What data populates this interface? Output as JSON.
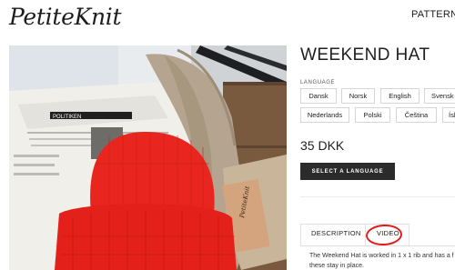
{
  "header": {
    "logo_text": "PetiteKnit",
    "nav": {
      "patterns_label": "PATTERNS"
    }
  },
  "product": {
    "title": "WEEKEND HAT",
    "language_label": "LANGUAGE",
    "languages_row1": [
      "Dansk",
      "Norsk",
      "English",
      "Svensk"
    ],
    "languages_row2": [
      "Nederlands",
      "Polski",
      "Čeština",
      "Ísl"
    ],
    "price": "35 DKK",
    "select_button": "SELECT A LANGUAGE",
    "tabs": {
      "description": "DESCRIPTION",
      "video": "VIDEO"
    },
    "description_line1": "The Weekend Hat is worked in 1 x 1 rib and has a f",
    "description_line2": "these stay in place.",
    "image_tag": "PetiteKnit",
    "newspaper_masthead": "POLITIKEN"
  },
  "colors": {
    "hat_red": "#e8261f",
    "button_dark": "#2b2b2b",
    "annotation_red": "#e01c1c"
  }
}
